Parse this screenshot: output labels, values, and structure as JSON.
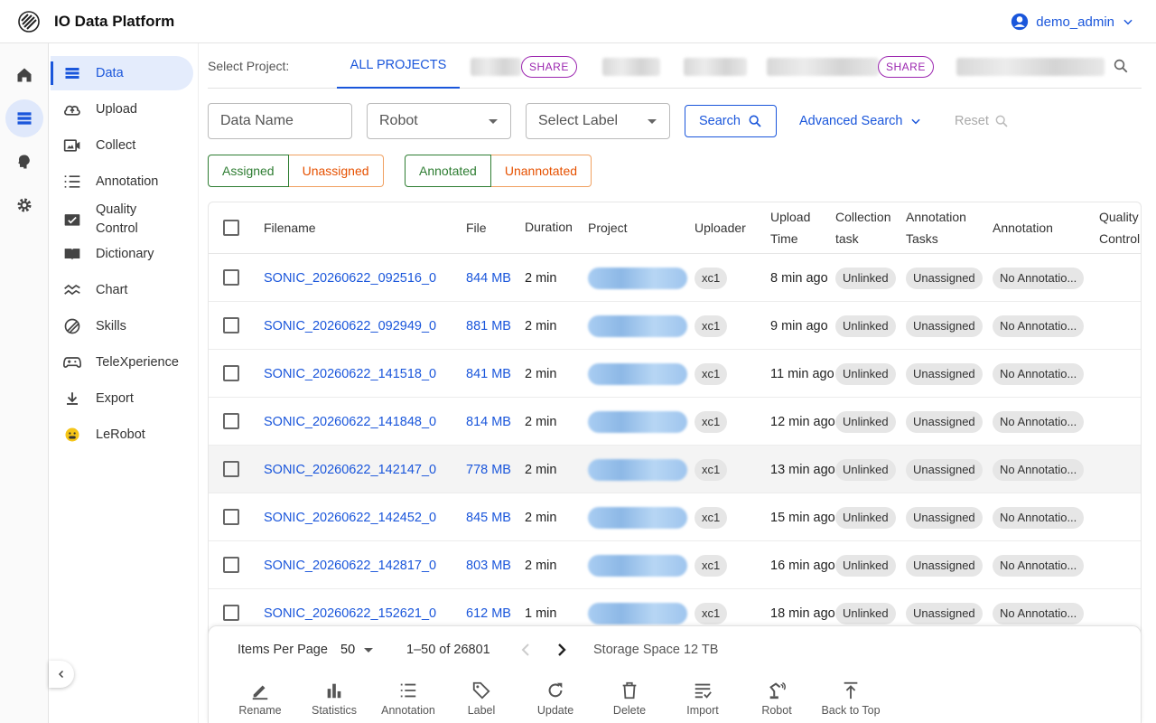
{
  "app": {
    "title": "IO Data Platform",
    "user": "demo_admin"
  },
  "sidebar": {
    "items": [
      {
        "label": "Data",
        "icon": "list-icon",
        "active": true
      },
      {
        "label": "Upload",
        "icon": "cloud-upload-icon"
      },
      {
        "label": "Collect",
        "icon": "video-icon"
      },
      {
        "label": "Annotation",
        "icon": "checklist-icon"
      },
      {
        "label": "Quality Control",
        "icon": "image-check-icon"
      },
      {
        "label": "Dictionary",
        "icon": "book-icon"
      },
      {
        "label": "Chart",
        "icon": "chart-icon"
      },
      {
        "label": "Skills",
        "icon": "skills-icon"
      },
      {
        "label": "TeleXperience",
        "icon": "gamepad-icon"
      },
      {
        "label": "Export",
        "icon": "download-icon"
      },
      {
        "label": "LeRobot",
        "icon": "emoji-icon"
      }
    ]
  },
  "projects": {
    "label": "Select Project:",
    "active_tab": "ALL PROJECTS",
    "share_label": "SHARE"
  },
  "filters": {
    "data_name_placeholder": "Data Name",
    "robot_placeholder": "Robot",
    "label_placeholder": "Select Label",
    "search": "Search",
    "advanced": "Advanced Search",
    "reset": "Reset",
    "assigned": "Assigned",
    "unassigned": "Unassigned",
    "annotated": "Annotated",
    "unannotated": "Unannotated"
  },
  "table": {
    "headers": {
      "filename": "Filename",
      "file": "File",
      "duration": "Duration",
      "project": "Project",
      "uploader": "Uploader",
      "upload_time_1": "Upload",
      "upload_time_2": "Time",
      "collection_1": "Collection",
      "collection_2": "task",
      "annot_tasks_1": "Annotation",
      "annot_tasks_2": "Tasks",
      "annotation": "Annotation",
      "qc_1": "Quality",
      "qc_2": "Control"
    },
    "rows": [
      {
        "filename": "SONIC_20260622_092516_0",
        "size": "844 MB",
        "duration": "2 min",
        "uploader": "xc1",
        "time": "8 min ago",
        "collection": "Unlinked",
        "tasks": "Unassigned",
        "annotation": "No Annotatio..."
      },
      {
        "filename": "SONIC_20260622_092949_0",
        "size": "881 MB",
        "duration": "2 min",
        "uploader": "xc1",
        "time": "9 min ago",
        "collection": "Unlinked",
        "tasks": "Unassigned",
        "annotation": "No Annotatio..."
      },
      {
        "filename": "SONIC_20260622_141518_0",
        "size": "841 MB",
        "duration": "2 min",
        "uploader": "xc1",
        "time": "11 min ago",
        "collection": "Unlinked",
        "tasks": "Unassigned",
        "annotation": "No Annotatio..."
      },
      {
        "filename": "SONIC_20260622_141848_0",
        "size": "814 MB",
        "duration": "2 min",
        "uploader": "xc1",
        "time": "12 min ago",
        "collection": "Unlinked",
        "tasks": "Unassigned",
        "annotation": "No Annotatio..."
      },
      {
        "filename": "SONIC_20260622_142147_0",
        "size": "778 MB",
        "duration": "2 min",
        "uploader": "xc1",
        "time": "13 min ago",
        "collection": "Unlinked",
        "tasks": "Unassigned",
        "annotation": "No Annotatio..."
      },
      {
        "filename": "SONIC_20260622_142452_0",
        "size": "845 MB",
        "duration": "2 min",
        "uploader": "xc1",
        "time": "15 min ago",
        "collection": "Unlinked",
        "tasks": "Unassigned",
        "annotation": "No Annotatio..."
      },
      {
        "filename": "SONIC_20260622_142817_0",
        "size": "803 MB",
        "duration": "2 min",
        "uploader": "xc1",
        "time": "16 min ago",
        "collection": "Unlinked",
        "tasks": "Unassigned",
        "annotation": "No Annotatio..."
      },
      {
        "filename": "SONIC_20260622_152621_0",
        "size": "612 MB",
        "duration": "1 min",
        "uploader": "xc1",
        "time": "18 min ago",
        "collection": "Unlinked",
        "tasks": "Unassigned",
        "annotation": "No Annotatio..."
      }
    ]
  },
  "pagination": {
    "items_per_page_label": "Items Per Page",
    "items_per_page": "50",
    "range": "1–50 of 26801",
    "storage": "Storage Space 12 TB"
  },
  "actions": {
    "rename": "Rename",
    "statistics": "Statistics",
    "annotation": "Annotation",
    "label": "Label",
    "update": "Update",
    "delete": "Delete",
    "import": "Import",
    "robot": "Robot",
    "back_to_top": "Back to Top"
  },
  "colors": {
    "accent": "#1a56db",
    "assigned": "#2e7d32",
    "unassigned": "#e65100",
    "share": "#9c27b0"
  }
}
